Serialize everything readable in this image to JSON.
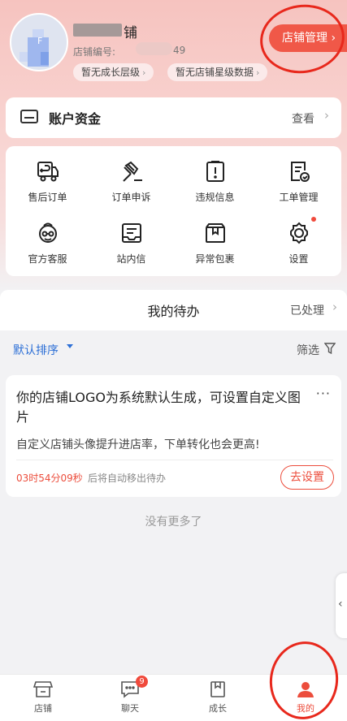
{
  "header": {
    "shop_name_visible": "铺",
    "shop_id_label": "店铺编号:",
    "shop_id_tail": "49",
    "growth_level_pill": "暂无成长层级",
    "star_data_pill": "暂无店铺星级数据",
    "manage_button": "店铺管理"
  },
  "funds": {
    "title": "账户资金",
    "view": "查看"
  },
  "grid": {
    "items": [
      {
        "label": "售后订单",
        "icon": "truck-return-icon"
      },
      {
        "label": "订单申诉",
        "icon": "gavel-icon"
      },
      {
        "label": "违规信息",
        "icon": "warning-clipboard-icon"
      },
      {
        "label": "工单管理",
        "icon": "work-order-icon"
      },
      {
        "label": "官方客服",
        "icon": "customer-service-icon"
      },
      {
        "label": "站内信",
        "icon": "inbox-message-icon"
      },
      {
        "label": "异常包裹",
        "icon": "package-icon"
      },
      {
        "label": "设置",
        "icon": "gear-icon"
      }
    ]
  },
  "todo": {
    "title": "我的待办",
    "processed": "已处理",
    "sort": "默认排序",
    "filter": "筛选",
    "task": {
      "title": "你的店铺LOGO为系统默认生成，可设置自定义图片",
      "description": "自定义店铺头像提升进店率，下单转化也会更高!",
      "timer": "03时54分09秒",
      "timer_tail": "后将自动移出待办",
      "action": "去设置",
      "more": "···"
    },
    "no_more": "没有更多了"
  },
  "nav": {
    "items": [
      {
        "label": "店铺",
        "icon": "store-icon"
      },
      {
        "label": "聊天",
        "icon": "chat-icon",
        "badge": "9"
      },
      {
        "label": "成长",
        "icon": "growth-icon"
      },
      {
        "label": "我的",
        "icon": "profile-icon",
        "active": true
      }
    ]
  },
  "colors": {
    "accent": "#ec4d3c",
    "manage_button": "#f05848",
    "link_blue": "#2c6fd6",
    "annotation_red": "#e8281c"
  }
}
